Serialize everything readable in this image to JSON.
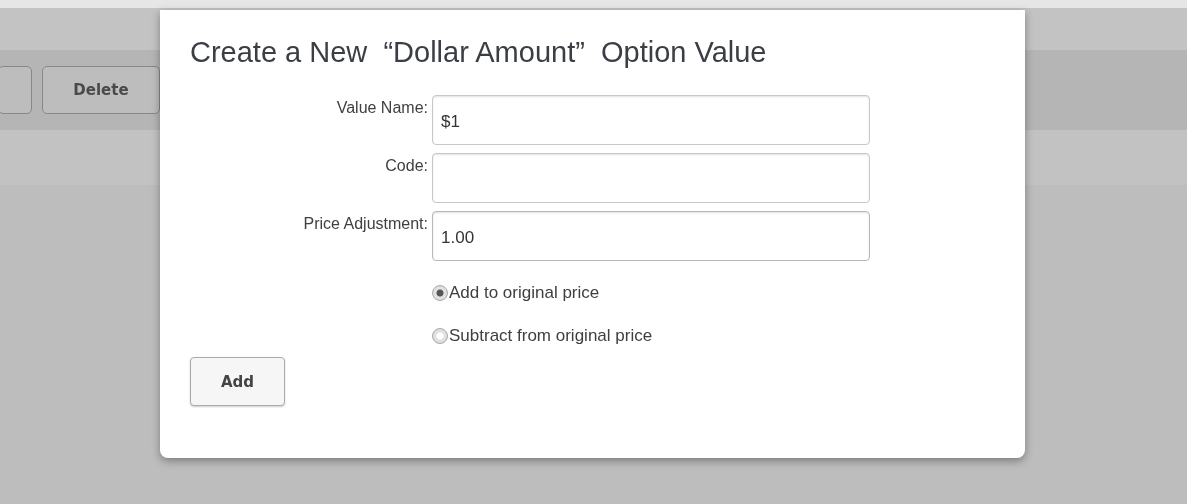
{
  "background": {
    "buttons": [
      {
        "label": "Delete"
      }
    ]
  },
  "dialog": {
    "title": "Create a New  “Dollar Amount”  Option Value",
    "fields": [
      {
        "label": "Value Name:",
        "value": "$1",
        "focused": false
      },
      {
        "label": "Code:",
        "focused": false
      },
      {
        "label": "Price Adjustment:",
        "value": "1.00",
        "focused": true
      }
    ],
    "options": [
      {
        "label": "Add to original price",
        "selected": true
      },
      {
        "label": "Subtract from original price",
        "selected": false
      }
    ],
    "submit": "Add"
  }
}
